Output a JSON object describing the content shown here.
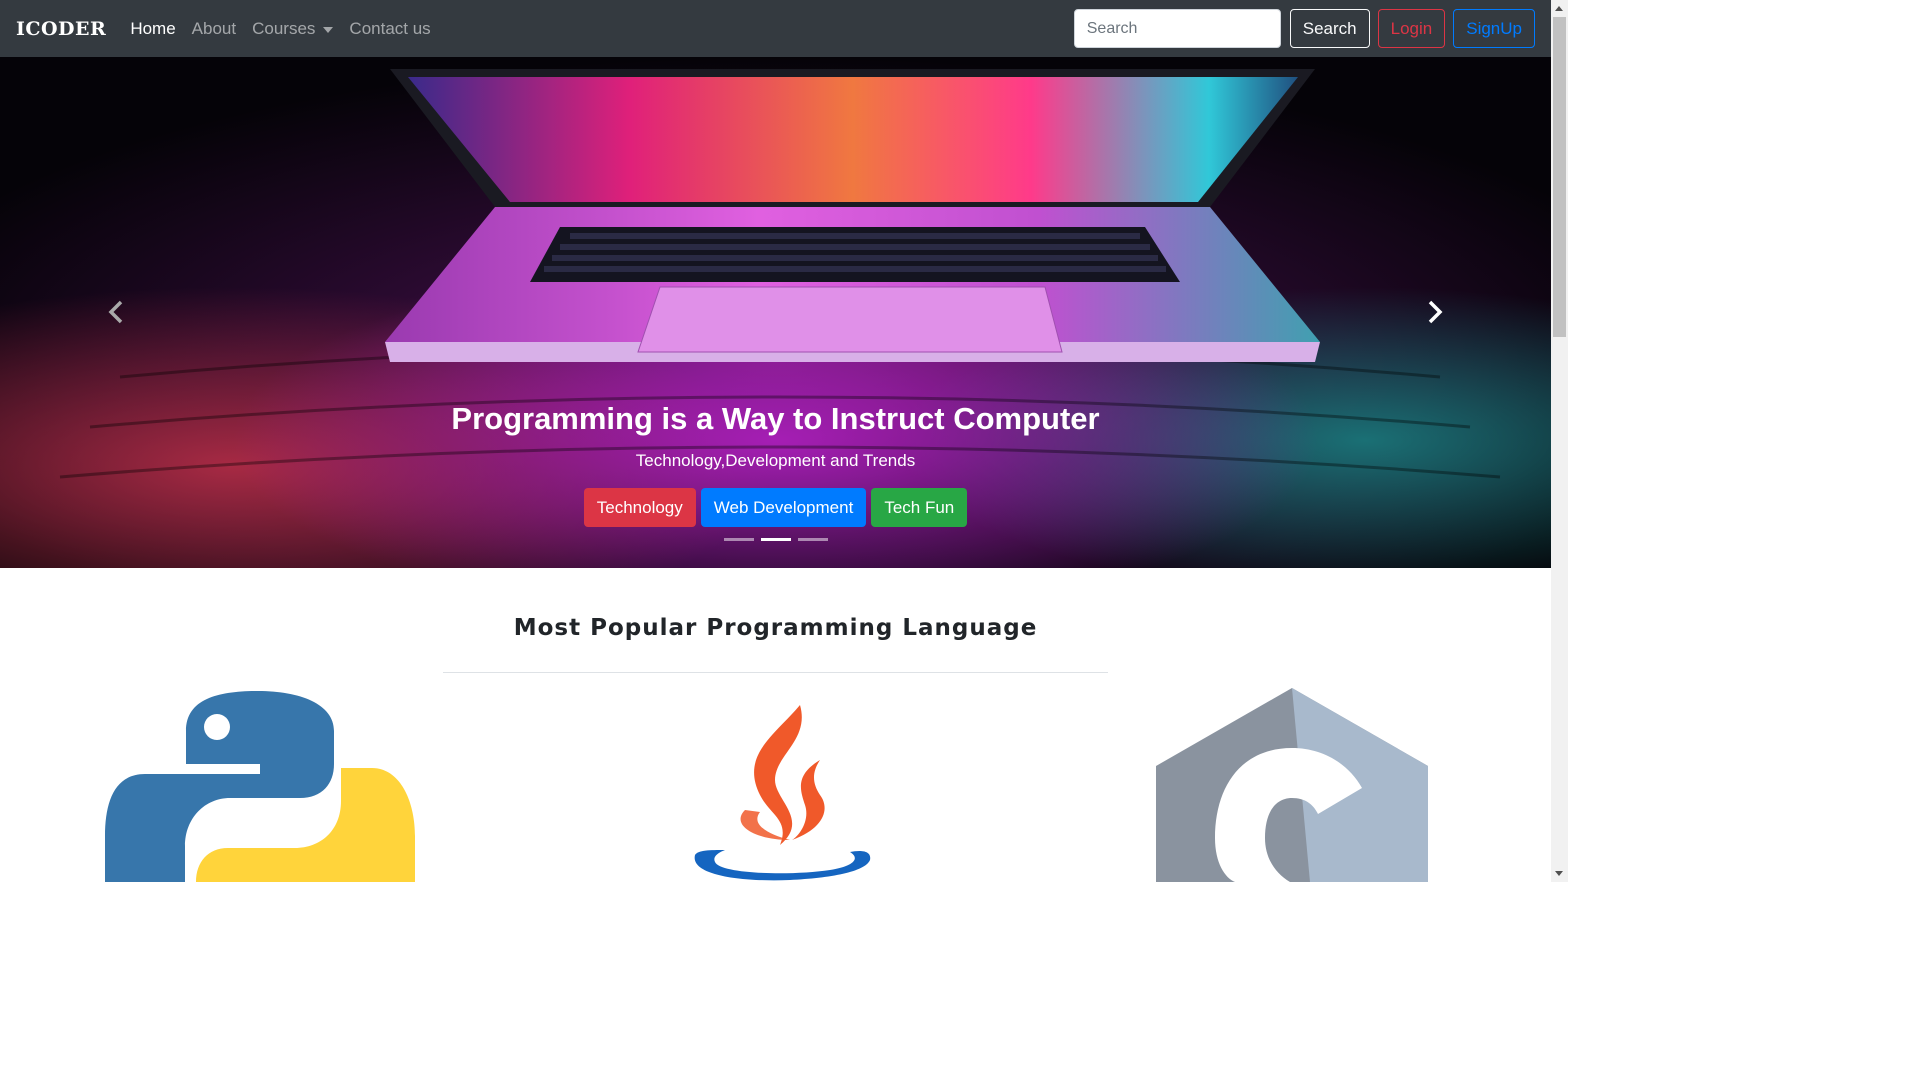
{
  "navbar": {
    "brand": "ICODER",
    "links": [
      {
        "label": "Home",
        "active": true
      },
      {
        "label": "About",
        "active": false
      },
      {
        "label": "Courses",
        "active": false,
        "dropdown": true
      },
      {
        "label": "Contact us",
        "active": false
      }
    ],
    "search_placeholder": "Search",
    "search_button": "Search",
    "login_button": "Login",
    "signup_button": "SignUp"
  },
  "carousel": {
    "title": "Programming is a Way to Instruct Computer",
    "subtitle": "Technology,Development and Trends",
    "buttons": [
      {
        "label": "Technology",
        "color": "#dc3545"
      },
      {
        "label": "Web Development",
        "color": "#007bff"
      },
      {
        "label": "Tech Fun",
        "color": "#28a745"
      }
    ],
    "active_indicator": 2,
    "indicator_count": 3
  },
  "section": {
    "title": "Most Popular Programming Language",
    "logos": [
      "python-logo",
      "java-logo",
      "c-logo"
    ]
  },
  "colors": {
    "navbar_bg": "#343a40",
    "danger": "#dc3545",
    "primary": "#007bff",
    "success": "#28a745"
  }
}
